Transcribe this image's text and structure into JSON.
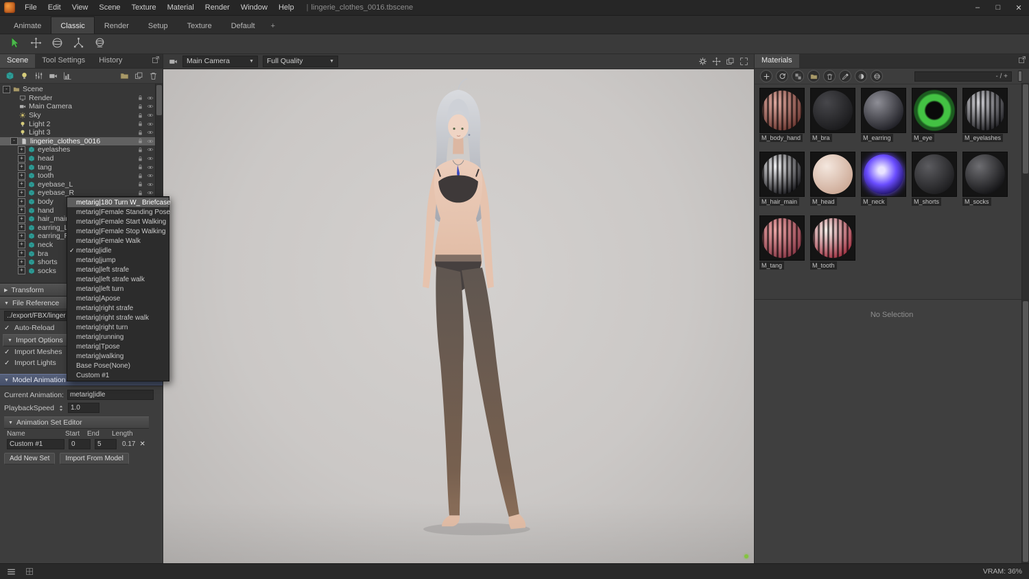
{
  "window": {
    "menus": [
      "File",
      "Edit",
      "View",
      "Scene",
      "Texture",
      "Material",
      "Render",
      "Window",
      "Help"
    ],
    "separator": "|",
    "title": "lingerie_clothes_0016.tbscene"
  },
  "workspace_tabs": [
    {
      "label": "Animate"
    },
    {
      "label": "Classic",
      "active": true
    },
    {
      "label": "Render"
    },
    {
      "label": "Setup"
    },
    {
      "label": "Texture"
    },
    {
      "label": "Default"
    },
    {
      "label": "+",
      "newtab": true
    }
  ],
  "main_toolbar_icons": [
    "cursor",
    "move",
    "rotate",
    "scale",
    "sphere-tool"
  ],
  "left_panel": {
    "tabs": [
      {
        "label": "Scene",
        "active": true
      },
      {
        "label": "Tool Settings"
      },
      {
        "label": "History"
      }
    ],
    "toolbar_icons_left": [
      "cube",
      "bulb",
      "sliders",
      "camera",
      "chart"
    ],
    "toolbar_icons_right": [
      "folder",
      "duplicate",
      "trash"
    ],
    "tree": [
      {
        "label": "Scene",
        "depth": 0,
        "type": "root",
        "exp": "-"
      },
      {
        "label": "Render",
        "depth": 1,
        "type": "render"
      },
      {
        "label": "Main Camera",
        "depth": 1,
        "type": "camera"
      },
      {
        "label": "Sky",
        "depth": 1,
        "type": "sky"
      },
      {
        "label": "Light 2",
        "depth": 1,
        "type": "light"
      },
      {
        "label": "Light 3",
        "depth": 1,
        "type": "light"
      },
      {
        "label": "lingerie_clothes_0016",
        "depth": 1,
        "type": "model",
        "exp": "-",
        "selected": true
      },
      {
        "label": "eyelashes",
        "depth": 2,
        "type": "mesh",
        "exp": "+"
      },
      {
        "label": "head",
        "depth": 2,
        "type": "mesh",
        "exp": "+"
      },
      {
        "label": "tang",
        "depth": 2,
        "type": "mesh",
        "exp": "+"
      },
      {
        "label": "tooth",
        "depth": 2,
        "type": "mesh",
        "exp": "+"
      },
      {
        "label": "eyebase_L",
        "depth": 2,
        "type": "mesh",
        "exp": "+"
      },
      {
        "label": "eyebase_R",
        "depth": 2,
        "type": "mesh",
        "exp": "+"
      },
      {
        "label": "body",
        "depth": 2,
        "type": "mesh",
        "exp": "+"
      },
      {
        "label": "hand",
        "depth": 2,
        "type": "mesh",
        "exp": "+"
      },
      {
        "label": "hair_main",
        "depth": 2,
        "type": "mesh",
        "exp": "+"
      },
      {
        "label": "earring_L",
        "depth": 2,
        "type": "mesh",
        "exp": "+"
      },
      {
        "label": "earring_R",
        "depth": 2,
        "type": "mesh",
        "exp": "+"
      },
      {
        "label": "neck",
        "depth": 2,
        "type": "mesh",
        "exp": "+"
      },
      {
        "label": "bra",
        "depth": 2,
        "type": "mesh",
        "exp": "+"
      },
      {
        "label": "shorts",
        "depth": 2,
        "type": "mesh",
        "exp": "+"
      },
      {
        "label": "socks",
        "depth": 2,
        "type": "mesh",
        "exp": "+"
      }
    ],
    "transform_header": "Transform",
    "file_reference": {
      "header": "File Reference",
      "path": "../export/FBX/linger",
      "auto_reload": "Auto-Reload",
      "import_options": "Import Options",
      "import_meshes": "Import Meshes",
      "import_lights": "Import Lights"
    },
    "model_animation": {
      "header": "Model Animation",
      "current_animation_label": "Current Animation:",
      "current_animation_value": "metarig|idle",
      "playback_speed_label": "PlaybackSpeed",
      "playback_speed_value": "1.0",
      "set_editor_header": "Animation Set Editor",
      "columns": [
        "Name",
        "Start",
        "End",
        "Length"
      ],
      "rows": [
        {
          "name": "Custom #1",
          "start": "0",
          "end": "5",
          "length": "0.17"
        }
      ],
      "buttons": [
        "Add New Set",
        "Import From Model"
      ]
    }
  },
  "animation_dropdown": [
    {
      "label": "metarig|180 Turn W_ Briefcase",
      "hover": true
    },
    {
      "label": "metarig|Female Standing Pose"
    },
    {
      "label": "metarig|Female Start Walking"
    },
    {
      "label": "metarig|Female Stop Walking"
    },
    {
      "label": "metarig|Female Walk"
    },
    {
      "label": "metarig|idle",
      "checked": true
    },
    {
      "label": "metarig|jump"
    },
    {
      "label": "metarig|left strafe"
    },
    {
      "label": "metarig|left strafe walk"
    },
    {
      "label": "metarig|left turn"
    },
    {
      "label": "metarig|Apose"
    },
    {
      "label": "metarig|right strafe"
    },
    {
      "label": "metarig|right strafe walk"
    },
    {
      "label": "metarig|right turn"
    },
    {
      "label": "metarig|running"
    },
    {
      "label": "metarig|Tpose"
    },
    {
      "label": "metarig|walking"
    },
    {
      "label": "Base Pose(None)"
    },
    {
      "label": "Custom #1"
    }
  ],
  "viewport": {
    "camera_select": "Main Camera",
    "quality_select": "Full Quality",
    "right_icons": [
      "gear",
      "move",
      "duplicate",
      "expand"
    ]
  },
  "materials_panel": {
    "tab": "Materials",
    "toolbar_icons": [
      "plus",
      "refresh",
      "checker",
      "folder",
      "trash",
      "eyedropper",
      "paint",
      "sphere"
    ],
    "filter_text": "- / +",
    "no_selection": "No Selection",
    "items": [
      {
        "name": "M_body_hand",
        "c1": "#dca89e",
        "c2": "#6e3a34",
        "pattern": "stripes"
      },
      {
        "name": "M_bra",
        "c1": "#47474b",
        "c2": "#1a1a1c",
        "pattern": "plain"
      },
      {
        "name": "M_earring",
        "c1": "#8e8e96",
        "c2": "#202026",
        "pattern": "plain"
      },
      {
        "name": "M_eye",
        "c1": "#43c243",
        "c2": "#1c5c20",
        "pattern": "iris"
      },
      {
        "name": "M_eyelashes",
        "c1": "#cfcfd4",
        "c2": "#26262a",
        "pattern": "stripes"
      },
      {
        "name": "M_hair_main",
        "c1": "#f0f0f2",
        "c2": "#1e1e22",
        "pattern": "stripes"
      },
      {
        "name": "M_head",
        "c1": "#f4e7de",
        "c2": "#cdaa97",
        "pattern": "plain"
      },
      {
        "name": "M_neck",
        "c1": "#6a4dff",
        "c2": "#140a50",
        "pattern": "glow"
      },
      {
        "name": "M_shorts",
        "c1": "#5c5c60",
        "c2": "#1d1d1f",
        "pattern": "plain"
      },
      {
        "name": "M_socks",
        "c1": "#6e6e72",
        "c2": "#141416",
        "pattern": "plain"
      },
      {
        "name": "M_tang",
        "c1": "#eaa6a6",
        "c2": "#8a3a48",
        "pattern": "stripes"
      },
      {
        "name": "M_tooth",
        "c1": "#f2efe9",
        "c2": "#a23646",
        "pattern": "stripes"
      }
    ]
  },
  "statusbar": {
    "vram": "VRAM: 36%"
  },
  "colors": {
    "accent_green": "#84c440",
    "selection_gray": "#616161",
    "mesh_icon_teal": "#2f9e98",
    "viewport_bg": "#cbc8c6"
  }
}
